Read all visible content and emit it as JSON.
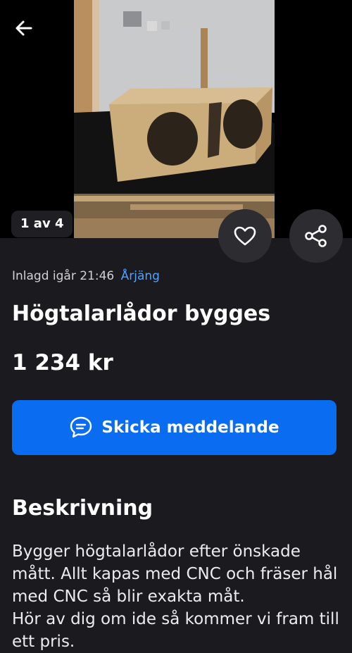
{
  "hero": {
    "image_counter": "1 av 4"
  },
  "icons": {
    "back": "arrow-left-icon",
    "favorite": "heart-icon",
    "share": "share-icon",
    "message": "chat-bubble-icon"
  },
  "listing": {
    "posted": "Inlagd igår 21:46",
    "location": "Årjäng",
    "title": "Högtalarlådor bygges",
    "price": "1 234 kr"
  },
  "actions": {
    "send_message_label": "Skicka meddelande"
  },
  "description": {
    "heading": "Beskrivning",
    "text": "Bygger högtalarlådor efter önskade mått. Allt kapas med CNC och fräser hål med CNC så blir exakta måt.\nHör av dig om ide så kommer vi fram till ett pris."
  },
  "colors": {
    "background": "#1b1b1f",
    "accent": "#0a6cf0",
    "link": "#4fa3ff"
  }
}
